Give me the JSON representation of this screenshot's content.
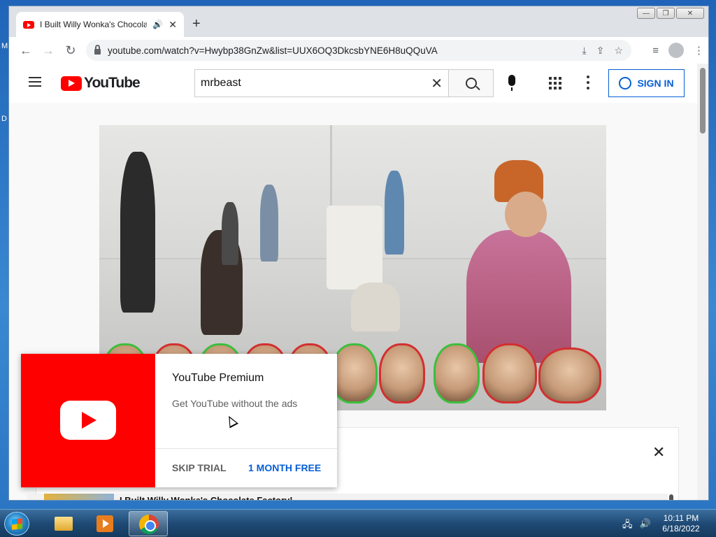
{
  "desktop": {
    "letters": [
      "M",
      "D"
    ]
  },
  "window": {
    "min": "—",
    "max": "❐",
    "close": "✕"
  },
  "tab": {
    "title": "I Built Willy Wonka's Chocolate Factory!",
    "speaker": "🔊",
    "close": "✕",
    "new": "+"
  },
  "toolbar": {
    "back": "←",
    "forward": "→",
    "reload": "↻",
    "url": "youtube.com/watch?v=Hwybp38GnZw&list=UUX6OQ3DkcsbYNE6H8uQQuVA",
    "install": "⤓",
    "share": "⇪",
    "star": "☆",
    "media": "≡",
    "menu": "⋮"
  },
  "youtube": {
    "logo": "YouTube",
    "search_value": "mrbeast",
    "search_clear": "✕",
    "sign_in": "SIGN IN"
  },
  "below": {
    "close": "✕",
    "video_title": "I Built Willy Wonka's Chocolate Factory!"
  },
  "promo": {
    "heading": "YouTube Premium",
    "subtitle": "Get YouTube without the ads",
    "skip": "SKIP TRIAL",
    "month": "1 MONTH FREE"
  },
  "taskbar": {
    "tray_icons": [
      "🖧",
      "🔊"
    ],
    "time": "10:11 PM",
    "date": "6/18/2022"
  },
  "colors": {
    "accent": "#065fd4",
    "brand": "#ff0000"
  }
}
